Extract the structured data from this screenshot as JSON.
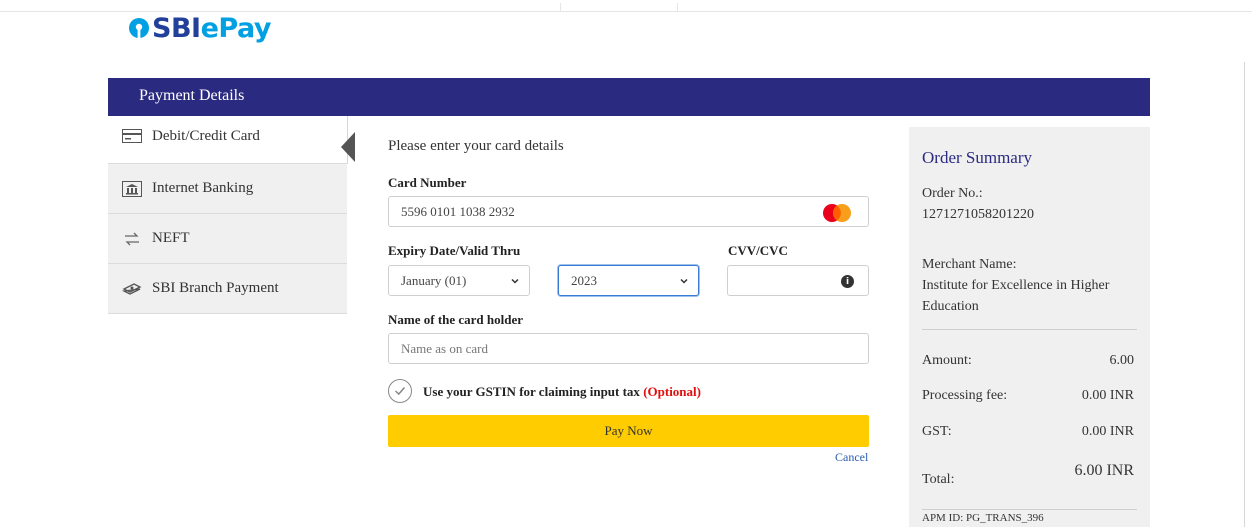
{
  "brand": {
    "name_part1": "SBI",
    "name_part2": "ePay",
    "color_primary": "#22409a",
    "color_secondary": "#00a0e3"
  },
  "header": {
    "title": "Payment Details",
    "bar_color": "#2a2a80"
  },
  "sidebar": {
    "items": [
      {
        "label": "Debit/Credit Card",
        "icon": "card-icon",
        "active": true
      },
      {
        "label": "Internet Banking",
        "icon": "bank-icon",
        "active": false
      },
      {
        "label": "NEFT",
        "icon": "transfer-icon",
        "active": false
      },
      {
        "label": "SBI Branch Payment",
        "icon": "cash-icon",
        "active": false
      }
    ]
  },
  "form": {
    "intro": "Please enter your card details",
    "card_number_label": "Card Number",
    "card_number_value": "5596 0101 1038 2932",
    "card_brand_icon": "mastercard-icon",
    "expiry_label": "Expiry Date/Valid Thru",
    "expiry_month_value": "January (01)",
    "expiry_year_value": "2023",
    "cvv_label": "CVV/CVC",
    "cvv_value": "",
    "cvv_info_icon": "info-icon",
    "holder_label": "Name of the card holder",
    "holder_placeholder": "Name as on card",
    "gst_text": "Use your GSTIN for claiming input tax",
    "gst_optional": "(Optional)",
    "pay_button": "Pay Now",
    "cancel_link": "Cancel",
    "pay_button_color": "#ffcc00"
  },
  "summary": {
    "title": "Order Summary",
    "order_no_label": "Order No.:",
    "order_no_value": "1271271058201220",
    "merchant_label": "Merchant Name:",
    "merchant_value": "Institute for Excellence in Higher Education",
    "amount_label": "Amount:",
    "amount_value": "6.00",
    "fee_label": "Processing fee:",
    "fee_value": "0.00 INR",
    "gst_label": "GST:",
    "gst_value": "0.00 INR",
    "total_label": "Total:",
    "total_value": "6.00 INR",
    "apm_id": "APM ID: PG_TRANS_396"
  }
}
